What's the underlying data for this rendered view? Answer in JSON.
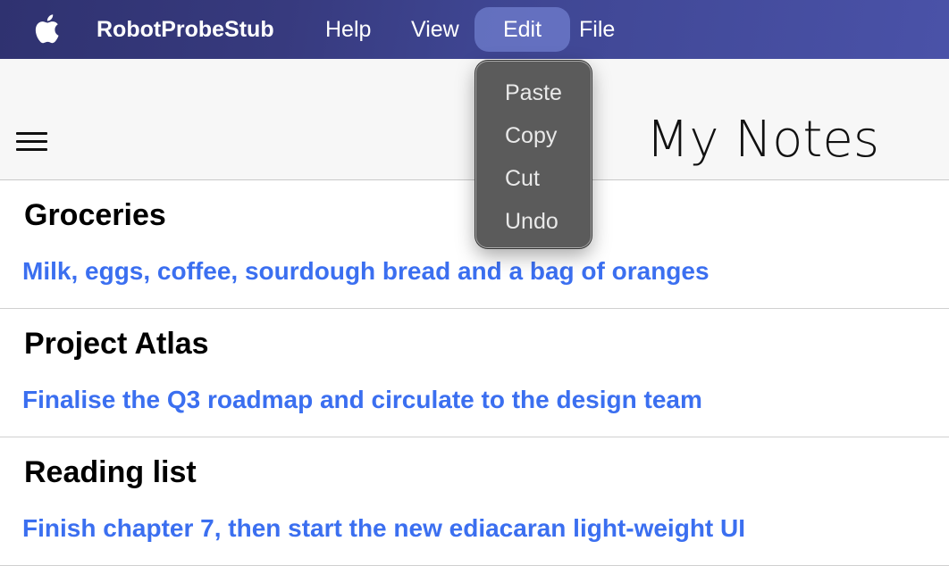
{
  "menubar": {
    "apple_icon": "apple-logo-icon",
    "app_name": "RobotProbeStub",
    "items": [
      "Help",
      "View",
      "Edit",
      "File"
    ],
    "active_item": "Edit"
  },
  "edit_menu": {
    "items": [
      "Paste",
      "Copy",
      "Cut",
      "Undo"
    ]
  },
  "header": {
    "menu_icon": "hamburger-menu-icon",
    "title": "My Notes"
  },
  "notes": [
    {
      "title": "Groceries",
      "body": "Milk, eggs, coffee, sourdough bread and a bag of oranges"
    },
    {
      "title": "Project Atlas",
      "body": "Finalise the Q3 roadmap and circulate to the design team"
    },
    {
      "title": "Reading list",
      "body": "Finish chapter 7, then start the new ediacaran light-weight UI"
    }
  ],
  "colors": {
    "menubar_start": "#2f3270",
    "menubar_end": "#4a52a8",
    "active_menu_highlight": "#7887d7",
    "dropdown_bg": "#5b5b5b",
    "note_body": "#3b6ff0",
    "header_bg": "#f7f7f7"
  }
}
